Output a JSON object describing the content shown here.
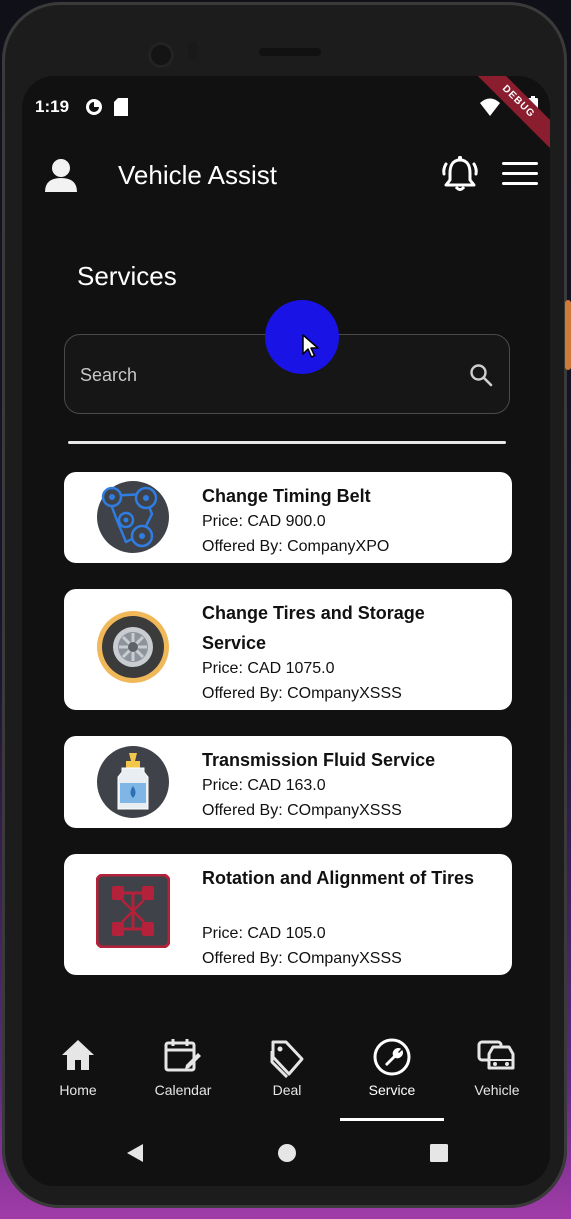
{
  "status_bar": {
    "time": "1:19",
    "debug_label": "DEBUG"
  },
  "app_bar": {
    "title": "Vehicle Assist"
  },
  "section": {
    "title": "Services"
  },
  "search": {
    "placeholder": "Search"
  },
  "services": [
    {
      "name": "Change Timing Belt",
      "price": "Price: CAD 900.0",
      "offered_by": "Offered By: CompanyXPO",
      "icon": "timing-belt-icon"
    },
    {
      "name": "Change Tires and Storage Service",
      "price": "Price: CAD 1075.0",
      "offered_by": "Offered By: COmpanyXSSS",
      "icon": "tire-icon"
    },
    {
      "name": "Transmission Fluid Service",
      "price": "Price: CAD 163.0",
      "offered_by": "Offered By: COmpanyXSSS",
      "icon": "fluid-bottle-icon"
    },
    {
      "name": "Rotation and Alignment of Tires",
      "price": "Price: CAD 105.0",
      "offered_by": "Offered By: COmpanyXSSS",
      "icon": "tire-rotation-icon"
    }
  ],
  "bottom_nav": {
    "items": [
      {
        "label": "Home",
        "icon": "home-icon"
      },
      {
        "label": "Calendar",
        "icon": "calendar-icon"
      },
      {
        "label": "Deal",
        "icon": "tag-icon"
      },
      {
        "label": "Service",
        "icon": "wrench-icon"
      },
      {
        "label": "Vehicle",
        "icon": "car-icon"
      }
    ],
    "selected": "Service"
  },
  "colors": {
    "screen_bg": "#121111",
    "card_bg": "#ffffff",
    "cursor": "#1a13e6",
    "accent_blue": "#2f7de1",
    "ribbon": "#8b1e2e"
  }
}
